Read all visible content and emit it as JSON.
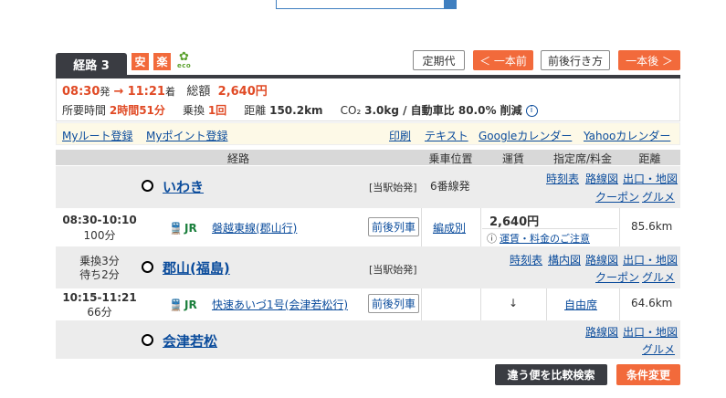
{
  "header": {
    "route_tab": "経路 3",
    "badge_safe": "安",
    "badge_easy": "楽",
    "eco": "eco",
    "commuter_btn": "定期代",
    "prev_btn": "＜ 一本前",
    "around_btn": "前後行き方",
    "next_btn": "一本後 ＞"
  },
  "summary": {
    "dep": "08:30",
    "dep_suffix": "発",
    "arrow": "→",
    "arr": "11:21",
    "arr_suffix": "着",
    "total_label": "総額",
    "total": "2,640円",
    "time_label": "所要時間",
    "time": "2時間51分",
    "transfer_label": "乗換",
    "transfer": "1回",
    "distance_label": "距離",
    "distance": "150.2km",
    "co2_label": "CO₂",
    "co2": "3.0kg / 自動車比 80.0% 削減"
  },
  "links": {
    "my_route": "Myルート登録",
    "my_point": "Myポイント登録",
    "print": "印刷",
    "text": "テキスト",
    "google": "Googleカレンダー",
    "yahoo": "Yahooカレンダー"
  },
  "columns": [
    "経路",
    "乗車位置",
    "運賃",
    "指定席/料金",
    "距離"
  ],
  "stations": [
    {
      "name": "いわき",
      "note": "[当駅始発]",
      "platform": "6番線発",
      "links": [
        "時刻表",
        "路線図",
        "出口・地図",
        "クーポン",
        "グルメ"
      ]
    },
    {
      "name": "郡山(福島)",
      "note": "[当駅始発]",
      "links": [
        "時刻表",
        "構内図",
        "路線図",
        "出口・地図",
        "クーポン",
        "グルメ"
      ]
    },
    {
      "name": "会津若松",
      "links": [
        "路線図",
        "出口・地図",
        "グルメ"
      ]
    }
  ],
  "segments": [
    {
      "time": "08:30-10:10",
      "duration": "100分",
      "operator": "JR",
      "line": "磐越東線(郡山行)",
      "around": "前後列車",
      "position": "編成別",
      "fare": "2,640円",
      "fare_note": "運賃・料金のご注意",
      "distance": "85.6km"
    },
    {
      "time": "10:15-11:21",
      "duration": "66分",
      "operator": "JR",
      "line": "快速あいづ1号(会津若松行)",
      "around": "前後列車",
      "fare_arrow": "↓",
      "seat": "自由席",
      "distance": "64.6km"
    }
  ],
  "transfer": {
    "wait1": "乗換3分",
    "wait2": "待ち2分"
  },
  "footer": {
    "compare": "違う便を比較検索",
    "conditions": "条件変更"
  },
  "colors": {
    "accent": "#f26a3b",
    "dark": "#3a3c42",
    "line1": "#c0507a",
    "line2": "#c97a2a"
  }
}
